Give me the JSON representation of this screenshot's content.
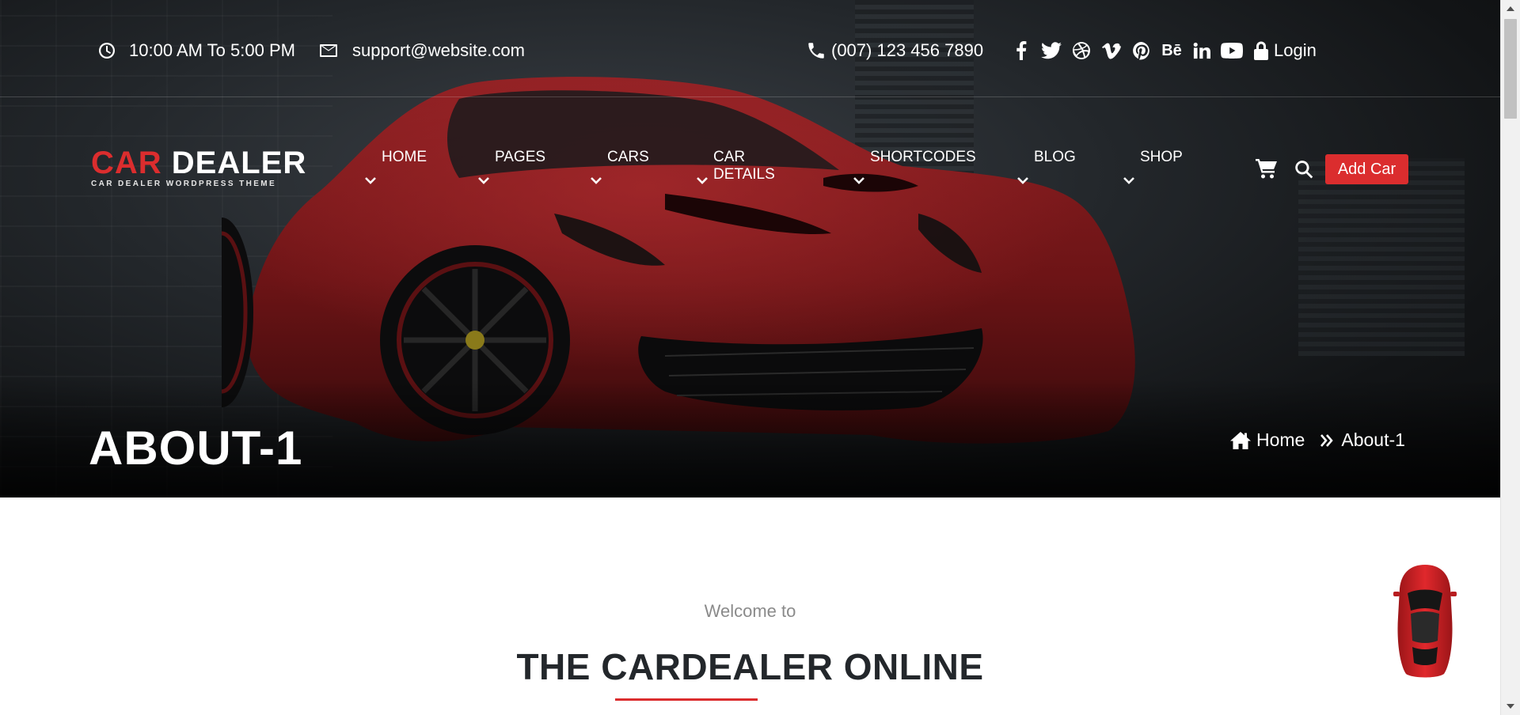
{
  "topbar": {
    "hours": "10:00 AM To 5:00 PM",
    "email": "support@website.com",
    "phone": "(007) 123 456 7890",
    "social": [
      {
        "name": "facebook",
        "glyph": "f"
      },
      {
        "name": "twitter",
        "glyph": ""
      },
      {
        "name": "dribbble",
        "glyph": ""
      },
      {
        "name": "vimeo",
        "glyph": "v"
      },
      {
        "name": "pinterest",
        "glyph": "P"
      },
      {
        "name": "behance",
        "glyph": "Bē"
      },
      {
        "name": "linkedin",
        "glyph": "in"
      },
      {
        "name": "youtube",
        "glyph": ""
      }
    ],
    "login": "Login"
  },
  "logo": {
    "text_red": "CAR",
    "text_white": " DEALER",
    "tagline": "CAR DEALER WORDPRESS THEME"
  },
  "nav": {
    "items": [
      "HOME",
      "PAGES",
      "CARS",
      "CAR DETAILS",
      "SHORTCODES",
      "BLOG",
      "SHOP"
    ]
  },
  "header": {
    "add_car": "Add Car"
  },
  "hero": {
    "title": "ABOUT-1",
    "breadcrumb_home": "Home",
    "breadcrumb_current": "About-1"
  },
  "content": {
    "welcome": "Welcome to",
    "title": "THE CARDEALER ONLINE"
  },
  "colors": {
    "accent": "#db2d2e",
    "dark": "#23272b",
    "muted": "#8a8a8a"
  }
}
